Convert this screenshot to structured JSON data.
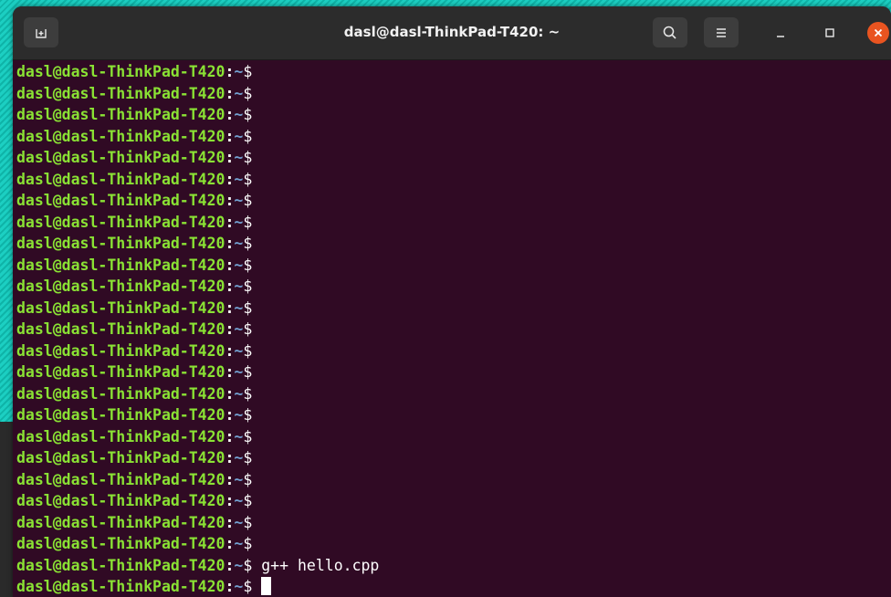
{
  "window": {
    "title": "dasl@dasl-ThinkPad-T420: ~"
  },
  "icons": {
    "new_tab": "new-tab-icon",
    "search": "search-icon",
    "menu": "hamburger-menu-icon",
    "minimize": "minimize-icon",
    "maximize": "maximize-icon",
    "close": "close-icon"
  },
  "colors": {
    "terminal_bg": "#300a24",
    "user_host": "#8ae234",
    "path": "#729fcf",
    "close_button": "#e95420"
  },
  "terminal": {
    "lines": [
      {
        "user": "dasl@dasl-ThinkPad-T420",
        "colon": ":",
        "path": "~",
        "dollar": "$",
        "cmd": ""
      },
      {
        "user": "dasl@dasl-ThinkPad-T420",
        "colon": ":",
        "path": "~",
        "dollar": "$",
        "cmd": ""
      },
      {
        "user": "dasl@dasl-ThinkPad-T420",
        "colon": ":",
        "path": "~",
        "dollar": "$",
        "cmd": ""
      },
      {
        "user": "dasl@dasl-ThinkPad-T420",
        "colon": ":",
        "path": "~",
        "dollar": "$",
        "cmd": ""
      },
      {
        "user": "dasl@dasl-ThinkPad-T420",
        "colon": ":",
        "path": "~",
        "dollar": "$",
        "cmd": ""
      },
      {
        "user": "dasl@dasl-ThinkPad-T420",
        "colon": ":",
        "path": "~",
        "dollar": "$",
        "cmd": ""
      },
      {
        "user": "dasl@dasl-ThinkPad-T420",
        "colon": ":",
        "path": "~",
        "dollar": "$",
        "cmd": ""
      },
      {
        "user": "dasl@dasl-ThinkPad-T420",
        "colon": ":",
        "path": "~",
        "dollar": "$",
        "cmd": ""
      },
      {
        "user": "dasl@dasl-ThinkPad-T420",
        "colon": ":",
        "path": "~",
        "dollar": "$",
        "cmd": ""
      },
      {
        "user": "dasl@dasl-ThinkPad-T420",
        "colon": ":",
        "path": "~",
        "dollar": "$",
        "cmd": ""
      },
      {
        "user": "dasl@dasl-ThinkPad-T420",
        "colon": ":",
        "path": "~",
        "dollar": "$",
        "cmd": ""
      },
      {
        "user": "dasl@dasl-ThinkPad-T420",
        "colon": ":",
        "path": "~",
        "dollar": "$",
        "cmd": ""
      },
      {
        "user": "dasl@dasl-ThinkPad-T420",
        "colon": ":",
        "path": "~",
        "dollar": "$",
        "cmd": ""
      },
      {
        "user": "dasl@dasl-ThinkPad-T420",
        "colon": ":",
        "path": "~",
        "dollar": "$",
        "cmd": ""
      },
      {
        "user": "dasl@dasl-ThinkPad-T420",
        "colon": ":",
        "path": "~",
        "dollar": "$",
        "cmd": ""
      },
      {
        "user": "dasl@dasl-ThinkPad-T420",
        "colon": ":",
        "path": "~",
        "dollar": "$",
        "cmd": ""
      },
      {
        "user": "dasl@dasl-ThinkPad-T420",
        "colon": ":",
        "path": "~",
        "dollar": "$",
        "cmd": ""
      },
      {
        "user": "dasl@dasl-ThinkPad-T420",
        "colon": ":",
        "path": "~",
        "dollar": "$",
        "cmd": ""
      },
      {
        "user": "dasl@dasl-ThinkPad-T420",
        "colon": ":",
        "path": "~",
        "dollar": "$",
        "cmd": ""
      },
      {
        "user": "dasl@dasl-ThinkPad-T420",
        "colon": ":",
        "path": "~",
        "dollar": "$",
        "cmd": ""
      },
      {
        "user": "dasl@dasl-ThinkPad-T420",
        "colon": ":",
        "path": "~",
        "dollar": "$",
        "cmd": ""
      },
      {
        "user": "dasl@dasl-ThinkPad-T420",
        "colon": ":",
        "path": "~",
        "dollar": "$",
        "cmd": ""
      },
      {
        "user": "dasl@dasl-ThinkPad-T420",
        "colon": ":",
        "path": "~",
        "dollar": "$",
        "cmd": ""
      },
      {
        "user": "dasl@dasl-ThinkPad-T420",
        "colon": ":",
        "path": "~",
        "dollar": "$",
        "cmd": " g++ hello.cpp"
      },
      {
        "user": "dasl@dasl-ThinkPad-T420",
        "colon": ":",
        "path": "~",
        "dollar": "$",
        "cmd": " ",
        "cursor": true
      }
    ]
  }
}
